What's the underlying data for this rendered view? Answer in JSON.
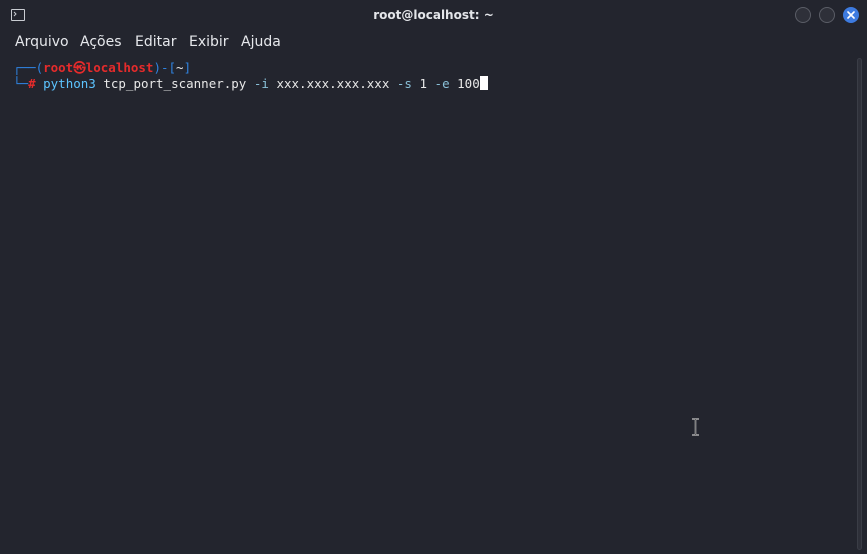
{
  "window": {
    "title": "root@localhost: ~",
    "icons": {
      "app": "terminal-icon",
      "minimize": "minimize-icon",
      "maximize": "maximize-icon",
      "close": "close-icon"
    },
    "colors": {
      "background": "#23252e",
      "close_button": "#3d7be0"
    }
  },
  "menubar": {
    "items": [
      {
        "label": "Arquivo"
      },
      {
        "label": "Ações"
      },
      {
        "label": "Editar"
      },
      {
        "label": "Exibir"
      },
      {
        "label": "Ajuda"
      }
    ]
  },
  "terminal": {
    "prompt": {
      "box_top": "┌──(",
      "user": "root㉿localhost",
      "mid": ")-[",
      "cwd": "~",
      "end": "]",
      "box_bottom": "└─",
      "symbol": "#"
    },
    "command": {
      "program": "python3",
      "script": "tcp_port_scanner.py",
      "flag_i": "-i",
      "ip": "xxx.xxx.xxx.xxx",
      "flag_s": "-s",
      "start": "1",
      "flag_e": "-e",
      "end": "100"
    },
    "colors": {
      "prompt_frame": "#2f83e0",
      "user": "#e52b2b",
      "program": "#5cc4ff",
      "text": "#e8e8e8"
    }
  }
}
